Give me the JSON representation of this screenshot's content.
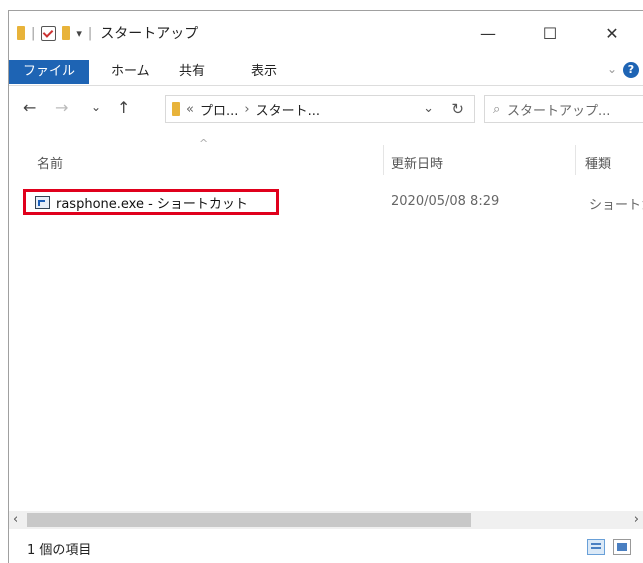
{
  "window": {
    "title": "スタートアップ",
    "controls": {
      "minimize": "—",
      "maximize": "☐",
      "close": "✕"
    }
  },
  "ribbon": {
    "tabs": [
      "ファイル",
      "ホーム",
      "共有",
      "表示"
    ]
  },
  "address": {
    "back": "←",
    "forward": "→",
    "recent": "⌄",
    "up": "↑",
    "crumbs": [
      "«",
      "プロ...",
      "›",
      "スタート..."
    ],
    "dropdown": "⌄",
    "refresh": "↻",
    "search_placeholder": "スタートアップ..."
  },
  "columns": {
    "name": "名前",
    "date": "更新日時",
    "type": "種類",
    "sort_indicator": "^"
  },
  "files": [
    {
      "name": "rasphone.exe - ショートカット",
      "date": "2020/05/08 8:29",
      "type": "ショートカット"
    }
  ],
  "status": {
    "count": "1 個の項目"
  },
  "scroll": {
    "left": "‹",
    "right": "›"
  },
  "icons": {
    "folder": "folder-icon",
    "shortcut": "shortcut-icon",
    "help": "help-icon",
    "details_view": "details-view-icon",
    "tiles_view": "tiles-view-icon"
  },
  "colors": {
    "file_tab": "#1e64b4",
    "highlight": "#e0001c",
    "folder": "#e8b33a"
  }
}
